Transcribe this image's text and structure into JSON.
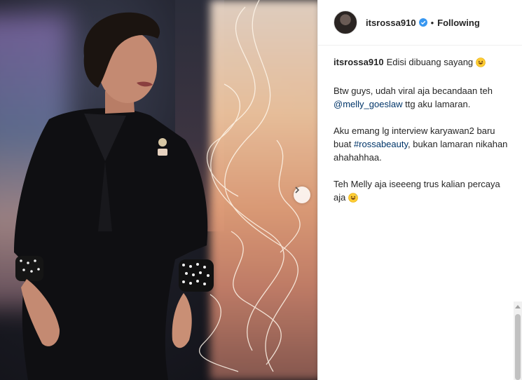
{
  "post": {
    "photo_alt": "",
    "next_icon": "chevron-right-icon"
  },
  "header": {
    "username": "itsrossa910",
    "verified_icon": "verified-badge-icon",
    "separator": "•",
    "follow_label": "Following"
  },
  "caption": {
    "username": "itsrossa910",
    "first_line": "Edisi dibuang sayang",
    "para2_before": "Btw guys, udah viral aja becandaan teh",
    "para2_mention": "@melly_goeslaw",
    "para2_after": "ttg aku lamaran.",
    "para3_before": "Aku emang lg interview karyawan2 baru buat",
    "para3_hashtag": "#rossabeauty",
    "para3_after": ", bukan lamaran nikahan ahahahhaa.",
    "para4": "Teh Melly aja iseeeng trus kalian percaya aja",
    "emoji_icon": "grinning-sweat-face-icon"
  },
  "colors": {
    "link": "#003569",
    "verified": "#3897f0",
    "text": "#262626",
    "border": "#efefef"
  }
}
